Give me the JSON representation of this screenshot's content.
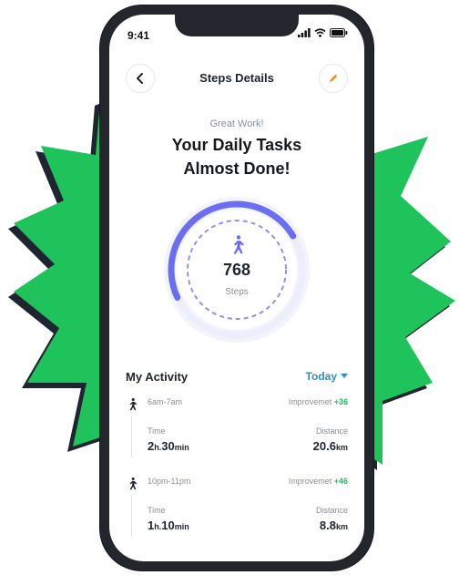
{
  "status": {
    "time": "9:41"
  },
  "header": {
    "title": "Steps Details"
  },
  "greeting": "Great Work!",
  "headline": {
    "line1": "Your Daily Tasks",
    "line2": "Almost Done!"
  },
  "steps": {
    "count": "768",
    "label": "Steps",
    "progress": 0.62
  },
  "activity": {
    "title": "My Activity",
    "filter": "Today",
    "entries": [
      {
        "range": "6am-7am",
        "improvement_label": "Improvemet",
        "improvement_value": "+36",
        "time_label": "Time",
        "time_h": "2",
        "time_h_unit": "h.",
        "time_m": "30",
        "time_m_unit": "min",
        "distance_label": "Distance",
        "distance_value": "20.6",
        "distance_unit": "km"
      },
      {
        "range": "10pm-11pm",
        "improvement_label": "Improvemet",
        "improvement_value": "+46",
        "time_label": "Time",
        "time_h": "1",
        "time_h_unit": "h.",
        "time_m": "10",
        "time_m_unit": "min",
        "distance_label": "Distance",
        "distance_value": "8.8",
        "distance_unit": "km"
      }
    ]
  },
  "colors": {
    "accent": "#6b6ef0",
    "burst": "#1fc35c",
    "edit": "#f28a2e",
    "filter": "#2f8fd0",
    "improve": "#2bbf5c"
  }
}
